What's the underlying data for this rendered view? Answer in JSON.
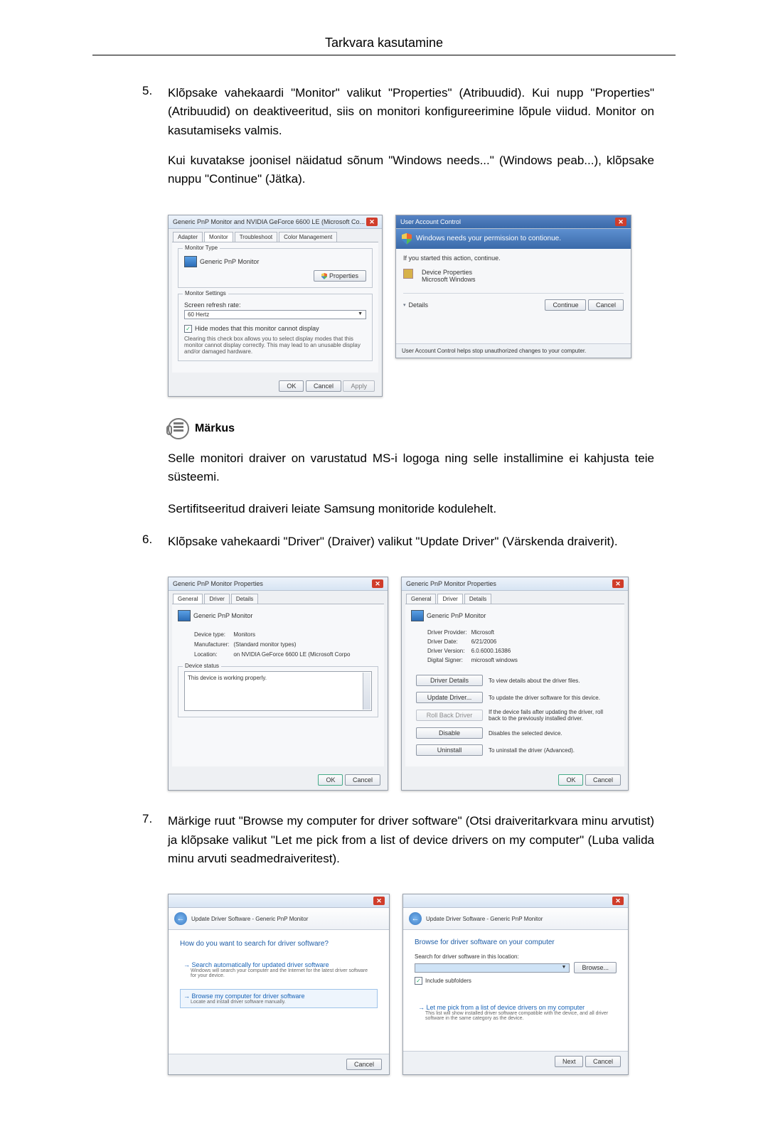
{
  "header": {
    "title": "Tarkvara kasutamine"
  },
  "step5": {
    "num": "5.",
    "para1": "Klõpsake vahekaardi \"Monitor\" valikut \"Properties\" (Atribuudid). Kui nupp \"Properties\" (Atribuudid) on deaktiveeritud, siis on monitori konfigureerimine lõpule viidud. Monitor on kasutamiseks valmis.",
    "para2": "Kui kuvatakse joonisel näidatud sõnum \"Windows needs...\" (Windows peab...), klõpsake nuppu \"Continue\" (Jätka)."
  },
  "monitorDialog": {
    "title": "Generic PnP Monitor and NVIDIA GeForce 6600 LE (Microsoft Co...",
    "tabs": {
      "adapter": "Adapter",
      "monitor": "Monitor",
      "troubleshoot": "Troubleshoot",
      "color": "Color Management"
    },
    "typeGroup": "Monitor Type",
    "typeValue": "Generic PnP Monitor",
    "propertiesBtn": "Properties",
    "settingsGroup": "Monitor Settings",
    "refreshLabel": "Screen refresh rate:",
    "refreshValue": "60 Hertz",
    "hideModes": "Hide modes that this monitor cannot display",
    "hideDesc": "Clearing this check box allows you to select display modes that this monitor cannot display correctly. This may lead to an unusable display and/or damaged hardware.",
    "ok": "OK",
    "cancel": "Cancel",
    "apply": "Apply"
  },
  "uac": {
    "title": "User Account Control",
    "banner": "Windows needs your permission to contionue.",
    "ifStarted": "If you started this action, continue.",
    "devProps": "Device Properties",
    "msWindows": "Microsoft Windows",
    "details": "Details",
    "continue": "Continue",
    "cancel": "Cancel",
    "footer": "User Account Control helps stop unauthorized changes to your computer."
  },
  "note": {
    "label": "Märkus",
    "p1": "Selle monitori draiver on varustatud MS-i logoga ning selle installimine ei kahjusta teie süsteemi.",
    "p2": "Sertifitseeritud draiveri leiate Samsung monitoride kodulehelt."
  },
  "step6": {
    "num": "6.",
    "text": "Klõpsake vahekaardi \"Driver\" (Draiver) valikut \"Update Driver\" (Värskenda draiverit)."
  },
  "propsGeneral": {
    "title": "Generic PnP Monitor Properties",
    "tabs": {
      "general": "General",
      "driver": "Driver",
      "details": "Details"
    },
    "name": "Generic PnP Monitor",
    "devTypeL": "Device type:",
    "devTypeV": "Monitors",
    "mfgL": "Manufacturer:",
    "mfgV": "(Standard monitor types)",
    "locL": "Location:",
    "locV": "on NVIDIA GeForce 6600 LE (Microsoft Corpo",
    "statusGroup": "Device status",
    "statusText": "This device is working properly.",
    "ok": "OK",
    "cancel": "Cancel"
  },
  "propsDriver": {
    "title": "Generic PnP Monitor Properties",
    "name": "Generic PnP Monitor",
    "provL": "Driver Provider:",
    "provV": "Microsoft",
    "dateL": "Driver Date:",
    "dateV": "6/21/2006",
    "verL": "Driver Version:",
    "verV": "6.0.6000.16386",
    "signL": "Digital Signer:",
    "signV": "microsoft windows",
    "btnDetails": "Driver Details",
    "descDetails": "To view details about the driver files.",
    "btnUpdate": "Update Driver...",
    "descUpdate": "To update the driver software for this device.",
    "btnRoll": "Roll Back Driver",
    "descRoll": "If the device fails after updating the driver, roll back to the previously installed driver.",
    "btnDisable": "Disable",
    "descDisable": "Disables the selected device.",
    "btnUninstall": "Uninstall",
    "descUninstall": "To uninstall the driver (Advanced).",
    "ok": "OK",
    "cancel": "Cancel"
  },
  "step7": {
    "num": "7.",
    "text": "Märkige ruut \"Browse my computer for driver software\" (Otsi draiveritarkvara minu arvutist) ja klõpsake valikut \"Let me pick from a list of device drivers on my computer\" (Luba valida minu arvuti seadmedraiveritest)."
  },
  "wiz1": {
    "breadcrumb": "Update Driver Software - Generic PnP Monitor",
    "heading": "How do you want to search for driver software?",
    "opt1": "Search automatically for updated driver software",
    "opt1desc": "Windows will search your computer and the Internet for the latest driver software for your device.",
    "opt2": "Browse my computer for driver software",
    "opt2desc": "Locate and install driver software manually.",
    "cancel": "Cancel"
  },
  "wiz2": {
    "breadcrumb": "Update Driver Software - Generic PnP Monitor",
    "heading": "Browse for driver software on your computer",
    "searchLabel": "Search for driver software in this location:",
    "browse": "Browse...",
    "include": "Include subfolders",
    "pick": "Let me pick from a list of device drivers on my computer",
    "pickDesc": "This list will show installed driver software compatible with the device, and all driver software in the same category as the device.",
    "next": "Next",
    "cancel": "Cancel"
  }
}
